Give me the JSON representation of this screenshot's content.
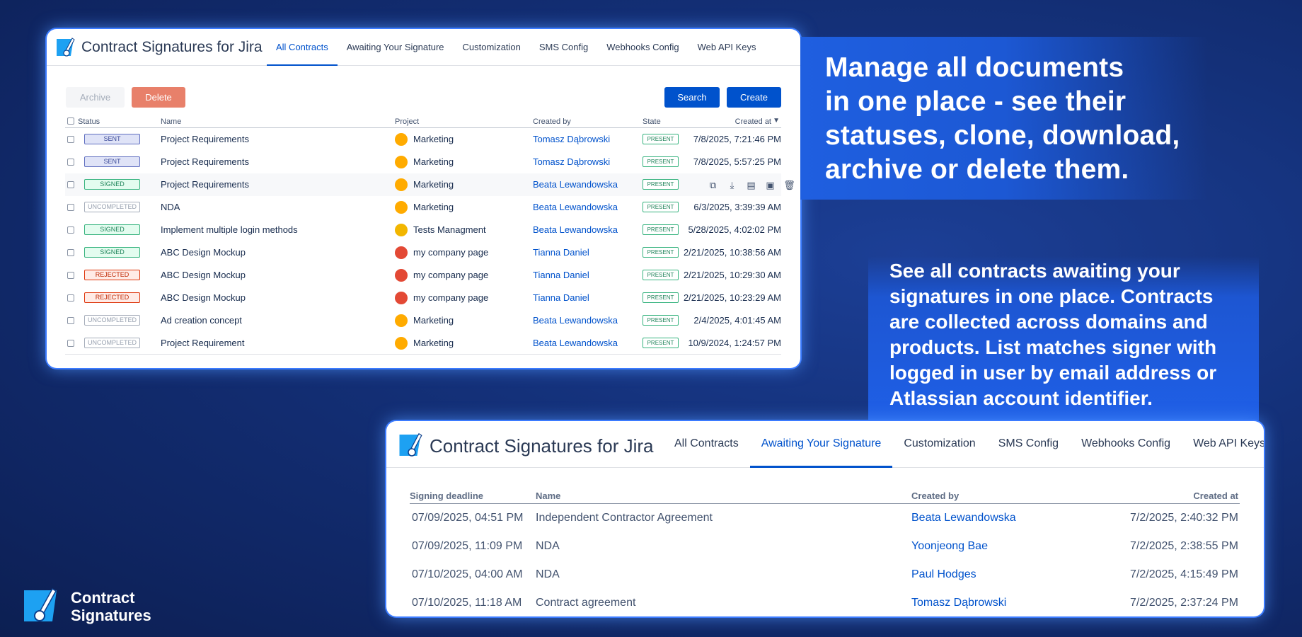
{
  "colors": {
    "accent": "#0052cc",
    "background": "#14317a",
    "callout": "#1f5fe0"
  },
  "panel1": {
    "app_title": "Contract Signatures for Jira",
    "tabs": [
      {
        "label": "All Contracts",
        "active": true
      },
      {
        "label": "Awaiting Your Signature",
        "active": false
      },
      {
        "label": "Customization",
        "active": false
      },
      {
        "label": "SMS Config",
        "active": false
      },
      {
        "label": "Webhooks Config",
        "active": false
      },
      {
        "label": "Web API Keys",
        "active": false
      }
    ],
    "buttons": {
      "archive": "Archive",
      "delete": "Delete",
      "search": "Search",
      "create": "Create"
    },
    "columns": {
      "status": "Status",
      "name": "Name",
      "project": "Project",
      "created_by": "Created by",
      "state": "State",
      "created_at": "Created at"
    },
    "sort_icon": "sort-desc-icon",
    "row_action_icons": [
      "clone-icon",
      "download-icon",
      "pdf-icon",
      "archive-icon",
      "trash-icon"
    ],
    "rows": [
      {
        "status": "SENT",
        "status_type": "sent",
        "name": "Project Requirements",
        "project": "Marketing",
        "project_icon": "marketing",
        "created_by": "Tomasz Dąbrowski",
        "state": "PRESENT",
        "created_at": "7/8/2025, 7:21:46 PM"
      },
      {
        "status": "SENT",
        "status_type": "sent",
        "name": "Project Requirements",
        "project": "Marketing",
        "project_icon": "marketing",
        "created_by": "Tomasz Dąbrowski",
        "state": "PRESENT",
        "created_at": "7/8/2025, 5:57:25 PM"
      },
      {
        "status": "SIGNED",
        "status_type": "signed",
        "name": "Project Requirements",
        "project": "Marketing",
        "project_icon": "marketing",
        "created_by": "Beata Lewandowska",
        "state": "PRESENT",
        "created_at": "",
        "hover": true
      },
      {
        "status": "UNCOMPLETED",
        "status_type": "uncompleted",
        "name": "NDA",
        "project": "Marketing",
        "project_icon": "marketing",
        "created_by": "Beata Lewandowska",
        "state": "PRESENT",
        "created_at": "6/3/2025, 3:39:39 AM"
      },
      {
        "status": "SIGNED",
        "status_type": "signed",
        "name": "Implement multiple login methods",
        "project": "Tests Managment",
        "project_icon": "tests",
        "created_by": "Beata Lewandowska",
        "state": "PRESENT",
        "created_at": "5/28/2025, 4:02:02 PM"
      },
      {
        "status": "SIGNED",
        "status_type": "signed",
        "name": "ABC Design Mockup",
        "project": "my company page",
        "project_icon": "company",
        "created_by": "Tianna Daniel",
        "state": "PRESENT",
        "created_at": "2/21/2025, 10:38:56 AM"
      },
      {
        "status": "REJECTED",
        "status_type": "rejected",
        "name": "ABC Design Mockup",
        "project": "my company page",
        "project_icon": "company",
        "created_by": "Tianna Daniel",
        "state": "PRESENT",
        "created_at": "2/21/2025, 10:29:30 AM"
      },
      {
        "status": "REJECTED",
        "status_type": "rejected",
        "name": "ABC Design Mockup",
        "project": "my company page",
        "project_icon": "company",
        "created_by": "Tianna Daniel",
        "state": "PRESENT",
        "created_at": "2/21/2025, 10:23:29 AM"
      },
      {
        "status": "UNCOMPLETED",
        "status_type": "uncompleted",
        "name": "Ad creation concept",
        "project": "Marketing",
        "project_icon": "marketing",
        "created_by": "Beata Lewandowska",
        "state": "PRESENT",
        "created_at": "2/4/2025, 4:01:45 AM"
      },
      {
        "status": "UNCOMPLETED",
        "status_type": "uncompleted",
        "name": "Project Requirement",
        "project": "Marketing",
        "project_icon": "marketing",
        "created_by": "Beata Lewandowska",
        "state": "PRESENT",
        "created_at": "10/9/2024, 1:24:57 PM"
      }
    ]
  },
  "callout1": {
    "lines": [
      "Manage all documents",
      "in one place - see their",
      "statuses, clone, download,",
      "archive or delete them."
    ]
  },
  "callout2": {
    "lines": [
      "See all contracts awaiting your",
      "signatures in one place. Contracts",
      "are collected across domains and",
      "products. List matches signer with",
      "logged in user by email address or",
      "Atlassian account identifier."
    ]
  },
  "panel2": {
    "app_title": "Contract Signatures for Jira",
    "tabs": [
      {
        "label": "All Contracts",
        "active": false
      },
      {
        "label": "Awaiting Your Signature",
        "active": true
      },
      {
        "label": "Customization",
        "active": false
      },
      {
        "label": "SMS Config",
        "active": false
      },
      {
        "label": "Webhooks Config",
        "active": false
      },
      {
        "label": "Web API Keys",
        "active": false
      }
    ],
    "columns": {
      "deadline": "Signing deadline",
      "name": "Name",
      "created_by": "Created by",
      "created_at": "Created at"
    },
    "rows": [
      {
        "deadline": "07/09/2025, 04:51 PM",
        "name": "Independent Contractor Agreement",
        "created_by": "Beata Lewandowska",
        "created_at": "7/2/2025, 2:40:32 PM"
      },
      {
        "deadline": "07/09/2025, 11:09 PM",
        "name": "NDA",
        "created_by": "Yoonjeong Bae",
        "created_at": "7/2/2025, 2:38:55 PM"
      },
      {
        "deadline": "07/10/2025, 04:00 AM",
        "name": "NDA",
        "created_by": "Paul Hodges",
        "created_at": "7/2/2025, 4:15:49 PM"
      },
      {
        "deadline": "07/10/2025, 11:18 AM",
        "name": "Contract agreement",
        "created_by": "Tomasz Dąbrowski",
        "created_at": "7/2/2025, 2:37:24 PM"
      }
    ]
  },
  "brand": {
    "line1": "Contract",
    "line2": "Signatures"
  }
}
